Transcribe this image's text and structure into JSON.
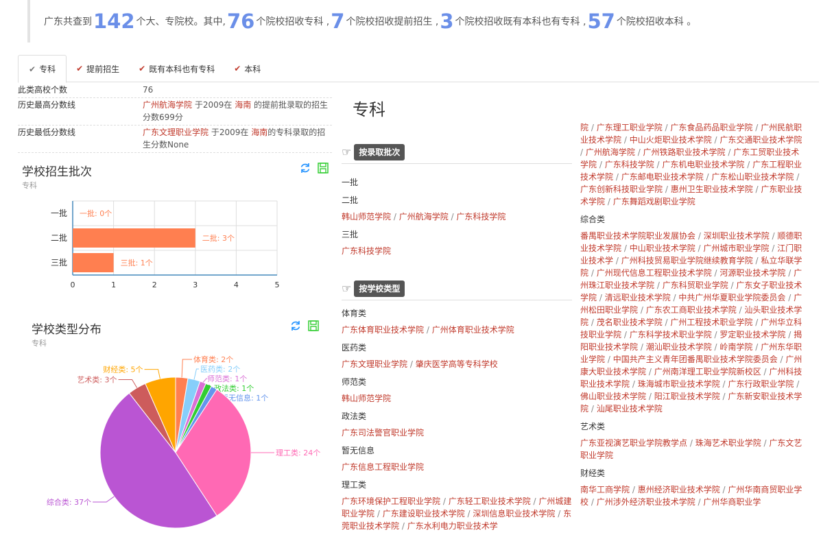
{
  "summary": {
    "p1": "广东共查到",
    "total": "142",
    "p2": "个大、专院校。其中,",
    "zk": "76",
    "p3": "个院校招收专科 ,",
    "tq": "7",
    "p4": "个院校招收提前招生 ,",
    "both": "3",
    "p5": "个院校招收既有本科也有专科 ,",
    "bk": "57",
    "p6": "个院校招收本科 。"
  },
  "tabs": [
    {
      "label": "专科"
    },
    {
      "label": "提前招生"
    },
    {
      "label": "既有本科也有专科"
    },
    {
      "label": "本科"
    }
  ],
  "stats": {
    "count_label": "此类高校个数",
    "count_value": "76",
    "high_label": "历史最高分数线",
    "high_school": "广州航海学院",
    "high_t1": " 于2009在 ",
    "high_prov": "海南",
    "high_t2": " 的提前批录取的招生分数699分",
    "low_label": "历史最低分数线",
    "low_school": "广东文理职业学院",
    "low_t1": " 于2009在 ",
    "low_prov": "海南",
    "low_t2": "的专科录取的招生分数None"
  },
  "batch_chart": {
    "title": "学校招生批次",
    "subtitle": "专科"
  },
  "type_chart": {
    "title": "学校类型分布",
    "subtitle": "专科"
  },
  "colors": {
    "accent": "#6b8fe8",
    "link": "#c0392b",
    "bar": "#ff7f50"
  },
  "chart_data": [
    {
      "type": "bar",
      "orientation": "horizontal",
      "categories": [
        "一批",
        "二批",
        "三批"
      ],
      "values": [
        0,
        3,
        1
      ],
      "data_labels": [
        "一批: 0个",
        "二批: 3个",
        "三批: 1个"
      ],
      "xlim": [
        0,
        5
      ],
      "xticks": [
        "0",
        "1",
        "2",
        "3",
        "4",
        "5"
      ]
    },
    {
      "type": "pie",
      "labels": [
        "体育类",
        "医药类",
        "师范类",
        "政法类",
        "暂无信息",
        "理工类",
        "综合类",
        "艺术类",
        "财经类"
      ],
      "values": [
        2,
        2,
        1,
        1,
        1,
        24,
        37,
        3,
        5
      ],
      "data_labels": [
        "体育类: 2个",
        "医药类: 2个",
        "师范类: 1个",
        "政法类: 1个",
        "暂无信息: 1个",
        "理工类: 24个",
        "综合类: 37个",
        "艺术类: 3个",
        "财经类: 5个"
      ],
      "colors": [
        "#ff7f50",
        "#87cefa",
        "#da70d6",
        "#32cd32",
        "#6495ed",
        "#ff69b4",
        "#ba55d3",
        "#cd5c5c",
        "#ffa500"
      ]
    }
  ],
  "right": {
    "title": "专科",
    "sec_batch": "按录取批次",
    "sec_type": "按学校类型",
    "batch1": "一批",
    "batch2": "二批",
    "batch2_links": [
      "韩山师范学院",
      "广州航海学院",
      "广东科技学院"
    ],
    "batch3": "三批",
    "batch3_links": [
      "广东科技学院"
    ],
    "cats": [
      {
        "name": "体育类",
        "links": [
          "广东体育职业技术学院",
          "广州体育职业技术学院"
        ]
      },
      {
        "name": "医药类",
        "links": [
          "广东文理职业学院",
          "肇庆医学高等专科学校"
        ]
      },
      {
        "name": "师范类",
        "links": [
          "韩山师范学院"
        ]
      },
      {
        "name": "政法类",
        "links": [
          "广东司法警官职业学院"
        ]
      },
      {
        "name": "暂无信息",
        "links": [
          "广东信息工程职业学院"
        ]
      },
      {
        "name": "理工类",
        "links": [
          "广东环境保护工程职业学院",
          "广东轻工职业技术学院",
          "广州城建职业学院",
          "广东建设职业技术学院",
          "深圳信息职业技术学院",
          "东莞职业技术学院",
          "广东水利电力职业技术学"
        ]
      }
    ],
    "col3_top": [
      "院",
      "广东理工职业学院",
      "广东食品药品职业学院",
      "广州民航职业技术学院",
      "中山火炬职业技术学院",
      "广东交通职业技术学院",
      "广州航海学院",
      "广州铁路职业技术学院",
      "广东工贸职业技术学院",
      "广东科技学院",
      "广东机电职业技术学院",
      "广东工程职业技术学院",
      "广东邮电职业技术学院",
      "广东松山职业技术学院",
      "广东创新科技职业学院",
      "惠州卫生职业技术学院",
      "广东职业技术学院",
      "广东舞蹈戏剧职业学院"
    ],
    "col3_cats": [
      {
        "name": "综合类",
        "links": [
          "番禺职业技术学院职业发展协会",
          "深圳职业技术学院",
          "顺德职业技术学院",
          "中山职业技术学院",
          "广州城市职业学院",
          "江门职业技术学",
          "广州科技贸易职业学院继续教育学院",
          "私立华联学院",
          "广州现代信息工程职业技术学院",
          "河源职业技术学院",
          "广州珠江职业技术学院",
          "广东科贸职业学院",
          "广东女子职业技术学院",
          "清远职业技术学院",
          "中共广州华夏职业学院委员会",
          "广州松田职业学院",
          "广东农工商职业技术学院",
          "汕头职业技术学院",
          "茂名职业技术学院",
          "广州工程技术职业学院",
          "广州华立科技职业学院",
          "广东科学技术职业学院",
          "罗定职业技术学院",
          "揭阳职业技术学院",
          "潮汕职业技术学院",
          "岭南学院",
          "广州东华职业学院",
          "中国共产主义青年团番禺职业技术学院委员会",
          "广州康大职业技术学院",
          "广州南洋理工职业学院新校区",
          "广州科技职业技术学院",
          "珠海城市职业技术学院",
          "广东行政职业学院",
          "佛山职业技术学院",
          "阳江职业技术学院",
          "广东新安职业技术学院",
          "汕尾职业技术学院"
        ]
      },
      {
        "name": "艺术类",
        "links": [
          "广东亚视演艺职业学院教学点",
          "珠海艺术职业学院",
          "广东文艺职业学院"
        ]
      },
      {
        "name": "财经类",
        "links": [
          "南华工商学院",
          "惠州经济职业技术学院",
          "广州华南商贸职业学校",
          "广州涉外经济职业技术学院",
          "广州华商职业学"
        ]
      }
    ]
  }
}
